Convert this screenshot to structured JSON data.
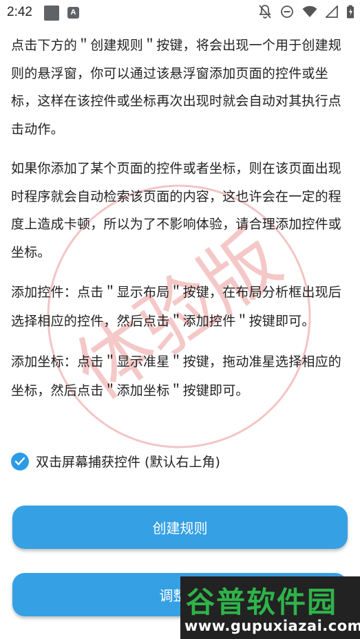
{
  "status_bar": {
    "time": "2:42",
    "notification_icons": [
      "square-notification-icon",
      "a-notification-icon"
    ],
    "notification_a_letter": "A",
    "system_icons": [
      "bell-off-icon",
      "do-not-disturb-icon",
      "wifi-icon",
      "signal-icon",
      "battery-icon"
    ]
  },
  "instructions": {
    "para1": "点击下方的＂创建规则＂按键，将会出现一个用于创建规则的悬浮窗，你可以通过该悬浮窗添加页面的控件或坐标，这样在该控件或坐标再次出现时就会自动对其执行点击动作。",
    "para2": "如果你添加了某个页面的控件或者坐标，则在该页面出现时程序就会自动检索该页面的内容，这也许会在一定的程度上造成卡顿，所以为了不影响体验，请合理添加控件或坐标。",
    "para3": "添加控件：点击＂显示布局＂按键，在布局分析框出现后选择相应的控件，然后点击＂添加控件＂按键即可。",
    "para4": "添加坐标：点击＂显示准星＂按键，拖动准星选择相应的坐标，然后点击＂添加坐标＂按键即可。"
  },
  "checkbox": {
    "label": "双击屏幕捕获控件 (默认右上角)",
    "checked": true
  },
  "buttons": {
    "create_rule": "创建规则",
    "adjust": "调整触"
  },
  "watermark_text": "体验版",
  "site_badge": {
    "title": "谷普软件园",
    "url": "www.gupuxiazai.com"
  },
  "colors": {
    "accent": "#35a0e4",
    "checkbox": "#2c9be6",
    "watermark": "#f0b8b8",
    "badge_green": "#2fb34a"
  }
}
